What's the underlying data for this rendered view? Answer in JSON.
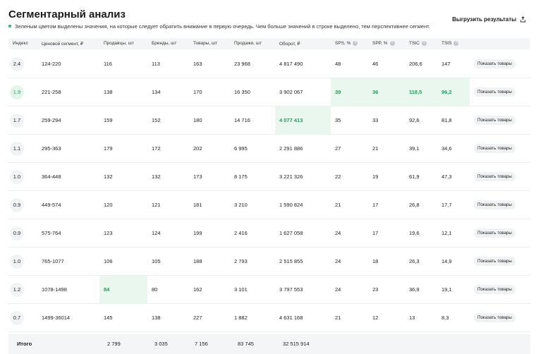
{
  "header": {
    "title": "Сегментарный анализ",
    "subtitle": "Зеленым цветом выделены значения, на которые следует обратить внимание в первую очередь. Чем больше значений в строке выделено, тем перспективнее сегмент.",
    "export_label": "Выгрузить результаты"
  },
  "table": {
    "columns": [
      "Индекс",
      "Ценовой сегмент, ₽",
      "Продавцы, шт",
      "Бренды, шт",
      "Товары, шт",
      "Продажи, шт",
      "Оборот, ₽",
      "SPS, %",
      "SPP, %",
      "TStC",
      "TStS"
    ],
    "action_label": "Показать товары",
    "rows": [
      {
        "cells": [
          "2.4",
          "124-220",
          "116",
          "113",
          "163",
          "23 968",
          "4 817 490",
          "48",
          "46",
          "206,6",
          "147"
        ],
        "highlight": []
      },
      {
        "cells": [
          "1.9",
          "221-258",
          "138",
          "134",
          "170",
          "16 350",
          "3 902 067",
          "39",
          "36",
          "118,5",
          "96,2"
        ],
        "highlight": [
          0,
          7,
          8,
          9,
          10
        ]
      },
      {
        "cells": [
          "1.7",
          "259-294",
          "159",
          "152",
          "180",
          "14 716",
          "4 077 413",
          "35",
          "33",
          "92,6",
          "81,8"
        ],
        "highlight": [
          6
        ]
      },
      {
        "cells": [
          "1.1",
          "295-363",
          "179",
          "172",
          "202",
          "6 995",
          "2 291 886",
          "27",
          "21",
          "39,1",
          "34,6"
        ],
        "highlight": []
      },
      {
        "cells": [
          "1.0",
          "364-448",
          "132",
          "132",
          "173",
          "8 175",
          "3 221 326",
          "22",
          "19",
          "61,9",
          "47,3"
        ],
        "highlight": []
      },
      {
        "cells": [
          "0.9",
          "449-574",
          "120",
          "121",
          "181",
          "3 210",
          "1 590 824",
          "21",
          "17",
          "26,8",
          "17,7"
        ],
        "highlight": []
      },
      {
        "cells": [
          "0.9",
          "575-764",
          "123",
          "124",
          "199",
          "2 416",
          "1 627 058",
          "24",
          "17",
          "19,6",
          "12,1"
        ],
        "highlight": []
      },
      {
        "cells": [
          "1.0",
          "765-1077",
          "106",
          "105",
          "188",
          "2 793",
          "2 515 855",
          "24",
          "18",
          "26,3",
          "14,9"
        ],
        "highlight": []
      },
      {
        "cells": [
          "1.2",
          "1078-1498",
          "84",
          "80",
          "162",
          "3 101",
          "3 797 553",
          "24",
          "23",
          "36,9",
          "19,1"
        ],
        "highlight": [
          2
        ]
      },
      {
        "cells": [
          "0.7",
          "1499-36014",
          "145",
          "138",
          "227",
          "1 882",
          "4 631 168",
          "21",
          "12",
          "13",
          "8,3"
        ],
        "highlight": []
      }
    ],
    "totals": {
      "label": "Итого",
      "values": [
        "2 799",
        "3 035",
        "7 156",
        "83 745",
        "32 515 914"
      ]
    }
  },
  "colors": {
    "highlight_bg": "#e9f7ef",
    "highlight_text": "#2a9d5c",
    "header_bg": "#f4f5f7"
  }
}
